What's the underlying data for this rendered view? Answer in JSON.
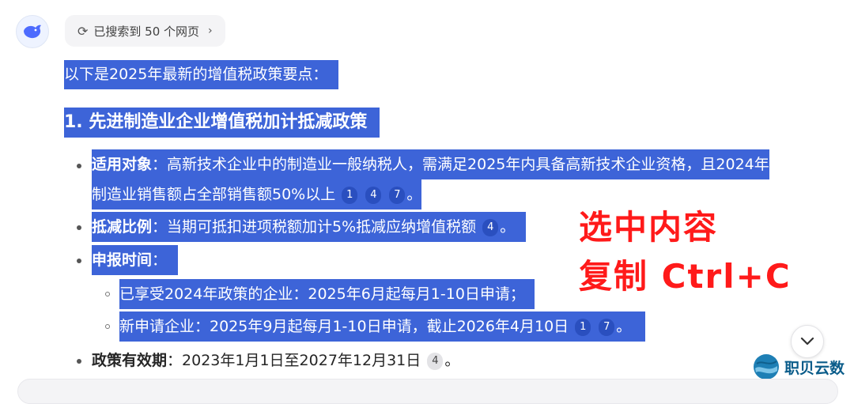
{
  "search": {
    "label": "已搜索到 50 个网页",
    "icon": "search-refresh-icon"
  },
  "intro": "以下是2025年最新的增值税政策要点：",
  "section": {
    "heading": "1. 先进制造业企业增值税加计抵减政策"
  },
  "items": [
    {
      "key": "适用对象",
      "sep": "：",
      "line1": "高新技术企业中的制造业一般纳税人，需满足2025年内具备高新技术企业资格，且2024年",
      "line2": "制造业销售额占全部销售额50%以上",
      "cites": [
        "1",
        "4",
        "7"
      ],
      "end": "。"
    },
    {
      "key": "抵减比例",
      "sep": "：",
      "text": "当期可抵扣进项税额加计5%抵减应纳增值税额",
      "cites": [
        "4"
      ],
      "end": "。"
    },
    {
      "key": "申报时间",
      "sep": "：",
      "subs": [
        {
          "text": "已享受2024年政策的企业：2025年6月起每月1-10日申请；"
        },
        {
          "text": "新申请企业：2025年9月起每月1-10日申请，截止2026年4月10日",
          "cites": [
            "1",
            "7"
          ],
          "end": "。"
        }
      ]
    },
    {
      "key": "政策有效期",
      "sep": "：",
      "text": "2023年1月1日至2027年12月31日",
      "cites": [
        "4"
      ],
      "end": "。"
    }
  ],
  "annotation": {
    "line1": "选中内容",
    "line2": "复制  Ctrl+C",
    "color": "#ff1a1a"
  },
  "watermark": {
    "text": "职贝云数"
  },
  "colors": {
    "selection": "#3d64d8",
    "annotation": "#ff1a1a"
  }
}
